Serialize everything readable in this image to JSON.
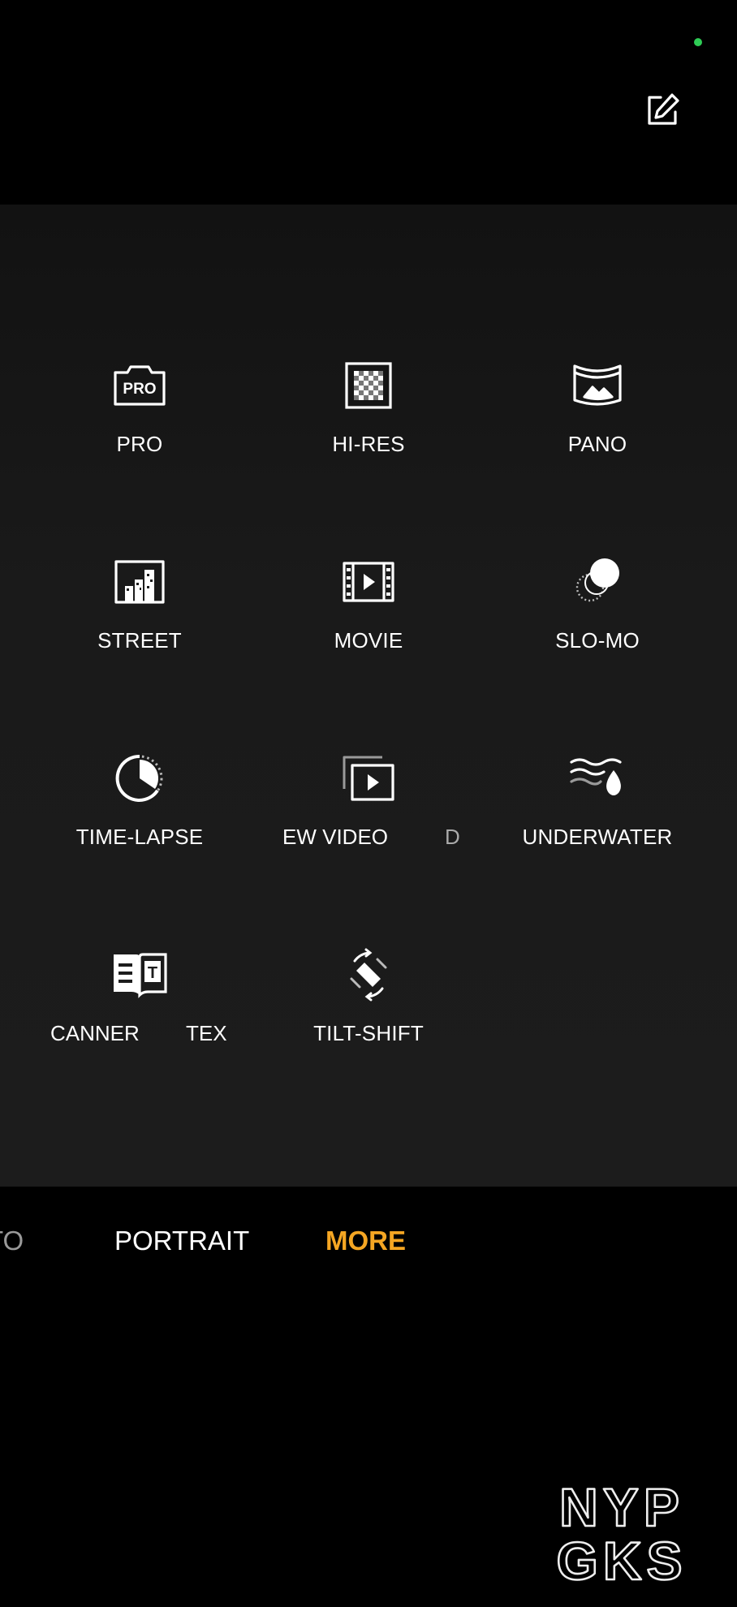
{
  "header": {
    "edit_icon": "edit-icon",
    "status_color": "#2ecc55"
  },
  "modes": [
    {
      "id": "pro",
      "label": "PRO",
      "icon": "pro-camera-icon",
      "icon_text": "PRO"
    },
    {
      "id": "hi-res",
      "label": "HI-RES",
      "icon": "hi-res-icon"
    },
    {
      "id": "pano",
      "label": "PANO",
      "icon": "panorama-icon"
    },
    {
      "id": "street",
      "label": "STREET",
      "icon": "street-icon"
    },
    {
      "id": "movie",
      "label": "MOVIE",
      "icon": "movie-icon"
    },
    {
      "id": "slo-mo",
      "label": "SLO-MO",
      "icon": "slo-mo-icon"
    },
    {
      "id": "time-lapse",
      "label": "TIME-LAPSE",
      "icon": "time-lapse-icon"
    },
    {
      "id": "dual-view-video",
      "label": "EW VIDEO",
      "label_tail": "D",
      "icon": "dual-view-video-icon"
    },
    {
      "id": "underwater",
      "label": "UNDERWATER",
      "icon": "underwater-icon"
    },
    {
      "id": "text-scanner",
      "label": "CANNER",
      "label_tail": "TEX",
      "icon": "text-scanner-icon",
      "icon_text": "T"
    },
    {
      "id": "tilt-shift",
      "label": "TILT-SHIFT",
      "icon": "tilt-shift-icon"
    }
  ],
  "bottom_tabs": [
    {
      "label": "TO",
      "active": false
    },
    {
      "label": "PORTRAIT",
      "active": false
    },
    {
      "label": "MORE",
      "active": true
    }
  ],
  "colors": {
    "accent": "#f5a623",
    "background": "#000000",
    "panel": "#1a1a1a"
  },
  "watermark": {
    "line1": "NYP",
    "line2": "GKS"
  }
}
